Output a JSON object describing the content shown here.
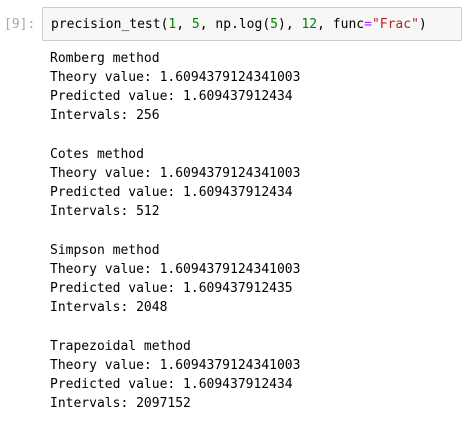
{
  "cell": {
    "prompt": "[9]:",
    "code": {
      "fn": "precision_test(",
      "arg1": "1",
      "sep1": ", ",
      "arg2": "5",
      "sep2": ", np.log(",
      "arg3": "5",
      "sep3": "), ",
      "arg4": "12",
      "sep4": ", func",
      "eq": "=",
      "str": "\"Frac\"",
      "close": ")"
    },
    "output": [
      {
        "method": "Romberg method",
        "theory": "Theory value: 1.6094379124341003",
        "predicted": "Predicted value: 1.609437912434",
        "intervals": "Intervals: 256"
      },
      {
        "method": "Cotes method",
        "theory": "Theory value: 1.6094379124341003",
        "predicted": "Predicted value: 1.609437912434",
        "intervals": "Intervals: 512"
      },
      {
        "method": "Simpson method",
        "theory": "Theory value: 1.6094379124341003",
        "predicted": "Predicted value: 1.609437912435",
        "intervals": "Intervals: 2048"
      },
      {
        "method": "Trapezoidal method",
        "theory": "Theory value: 1.6094379124341003",
        "predicted": "Predicted value: 1.609437912434",
        "intervals": "Intervals: 2097152"
      }
    ]
  },
  "colors": {
    "prompt": "#a8a8a8",
    "input_bg": "#f7f7f7",
    "input_border": "#cfcfcf",
    "number": "#008000",
    "string": "#ba2121",
    "operator": "#aa22ff"
  }
}
